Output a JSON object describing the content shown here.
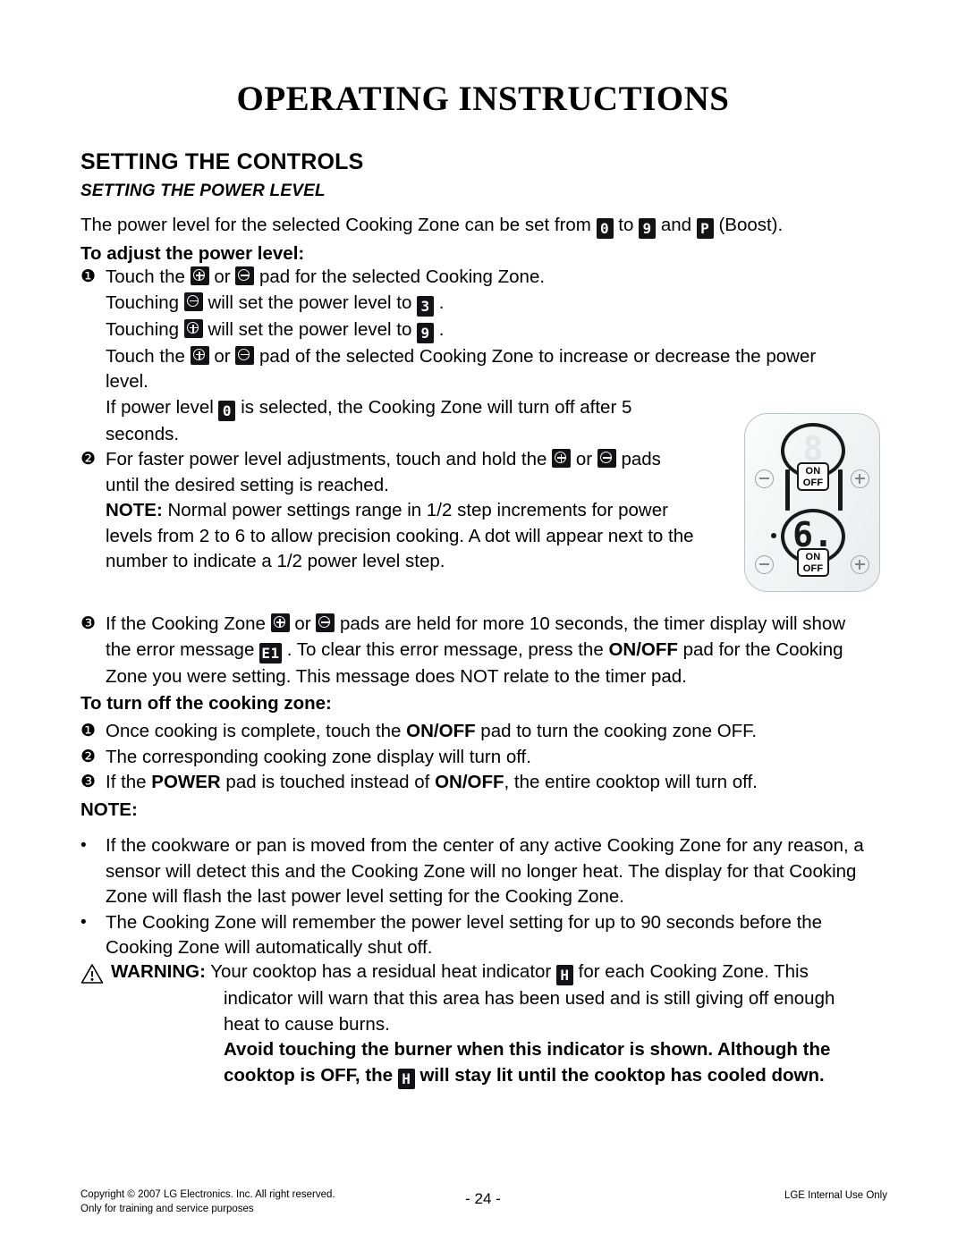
{
  "document": {
    "title": "OPERATING INSTRUCTIONS",
    "section_heading": "SETTING THE CONTROLS",
    "subsection_heading": "SETTING THE POWER LEVEL"
  },
  "intro": {
    "part1": "The power level for the selected Cooking Zone can be set from",
    "seg_from": "0",
    "part2": "to",
    "seg_to": "9",
    "part3": "and",
    "seg_boost": "P",
    "part4": "(Boost)."
  },
  "adjust": {
    "heading": "To adjust the power level:",
    "item1_marker": "❶",
    "item1_a": "Touch the",
    "item1_b": "or",
    "item1_c": "pad for the selected Cooking Zone.",
    "line2_a": "Touching",
    "line2_b": "will set the power level to",
    "line2_value": "3",
    "line2_end": ".",
    "line3_a": "Touching",
    "line3_b": "will set the power level to",
    "line3_value": "9",
    "line3_end": ".",
    "line4_a": "Touch the",
    "line4_b": "or",
    "line4_c": "pad of the selected Cooking Zone to increase or decrease the power",
    "line5": "level.",
    "line6_a": "If power level",
    "line6_value": "0",
    "line6_b": "is selected, the Cooking Zone will turn off after 5",
    "line7": "seconds.",
    "item2_marker": "❷",
    "item2_a": "For faster power level adjustments, touch and hold the",
    "item2_b": "or",
    "item2_c": "pads",
    "item2_line2": "until the desired setting is reached.",
    "note_label": "NOTE:",
    "note_line1": "Normal power settings range in 1/2 step increments for power",
    "note_line2": "levels from 2 to 6 to allow precision cooking. A dot will appear next to the",
    "note_line3": "number to indicate a 1/2 power level step."
  },
  "error_item": {
    "marker": "❸",
    "a": "If the Cooking Zone",
    "b": "or",
    "c": "pads are held for more 10 seconds, the timer display will show",
    "line2_a": "the error message",
    "seg_error": "E1",
    "line2_b": ". To clear this error message, press the",
    "line2_bold": "ON/OFF",
    "line2_c": "pad for the Cooking",
    "line3": "Zone you were setting. This message does NOT relate to the timer pad."
  },
  "turn_off": {
    "heading": "To turn off the cooking zone:",
    "items": [
      {
        "marker": "❶",
        "a": "Once cooking is complete, touch the ",
        "bold": "ON/OFF",
        "b": " pad to turn the cooking zone OFF."
      },
      {
        "marker": "❷",
        "a": "The corresponding cooking zone display will turn off.",
        "bold": "",
        "b": ""
      },
      {
        "marker": "❸",
        "a": "If the ",
        "bold": "POWER",
        "b": " pad is touched instead of ",
        "bold2": "ON/OFF",
        "c": ", the entire cooktop will turn off."
      }
    ]
  },
  "note_section": {
    "heading": "NOTE:",
    "bullets": [
      {
        "marker": "•",
        "lines": [
          "If the cookware or pan is moved from the center of any active Cooking Zone for any reason, a",
          "sensor will detect this and the Cooking Zone will no longer heat. The display for that Cooking",
          "Zone will flash the last power level setting for the Cooking Zone."
        ]
      },
      {
        "marker": "•",
        "lines": [
          "The Cooking Zone will remember the power level setting for up to 90 seconds before the",
          "Cooking Zone will automatically shut off."
        ]
      }
    ]
  },
  "warning": {
    "label": "WARNING:",
    "line1_a": "Your cooktop has a residual heat indicator",
    "seg_h": "H",
    "line1_b": "for each Cooking Zone. This",
    "line2": "indicator will warn that this area has been used and is still giving off enough",
    "line3": "heat to cause burns.",
    "bold_line1": "Avoid touching the burner when this indicator is shown. Although the",
    "bold_line2_a": "cooktop is OFF, the",
    "bold_line2_b": "will stay lit until the cooktop has cooled down."
  },
  "control_panel": {
    "top_display": "8",
    "bottom_display": "6.",
    "onoff_line1": "ON",
    "onoff_line2": "OFF"
  },
  "footer": {
    "copyright_line1": "Copyright © 2007 LG Electronics. Inc. All right reserved.",
    "copyright_line2": "Only for training and service purposes",
    "page_number": "- 24 -",
    "internal_note": "LGE Internal Use Only"
  }
}
